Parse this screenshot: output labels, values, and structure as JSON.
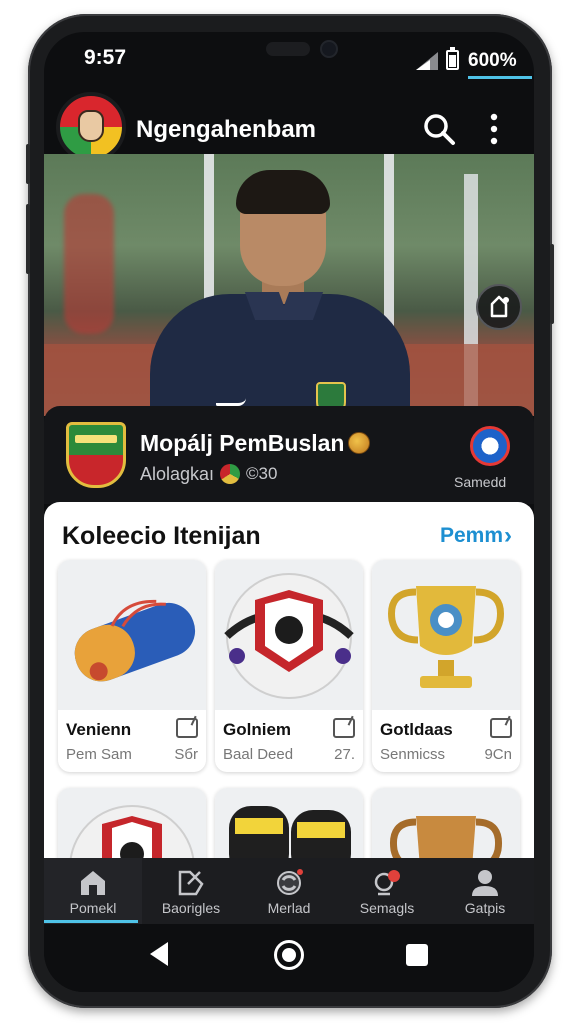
{
  "status_bar": {
    "time": "9:57",
    "battery": "600%"
  },
  "header": {
    "title": "Ngengahenbam",
    "search_icon": "search-icon",
    "more_icon": "more-vert-icon"
  },
  "hero": {
    "share_icon": "share-icon"
  },
  "profile": {
    "name": "Mopálj PemBuslan",
    "subtitle": "Alolagkaı",
    "count": "©30",
    "sponsor_label": "Samedd"
  },
  "collection": {
    "title": "Koleecio Itenijan",
    "more_label": "Pemm",
    "items": [
      {
        "label": "Venienn",
        "sub": "Pem Sam",
        "value": "Sбr"
      },
      {
        "label": "Golniem",
        "sub": "Baal Deed",
        "value": "27."
      },
      {
        "label": "Gotldaas",
        "sub": "Senmicss",
        "value": "9Cn"
      }
    ]
  },
  "bottom_nav": [
    {
      "label": "Pomekl",
      "icon": "home-icon",
      "active": true
    },
    {
      "label": "Baorigles",
      "icon": "trophy-icon",
      "active": false
    },
    {
      "label": "Merlad",
      "icon": "refresh-icon",
      "active": false
    },
    {
      "label": "Semagls",
      "icon": "notification-icon",
      "active": false
    },
    {
      "label": "Gatpis",
      "icon": "profile-icon",
      "active": false
    }
  ],
  "colors": {
    "accent": "#4fc3e8",
    "link": "#1d8fd1",
    "background": "#0d0e10"
  }
}
